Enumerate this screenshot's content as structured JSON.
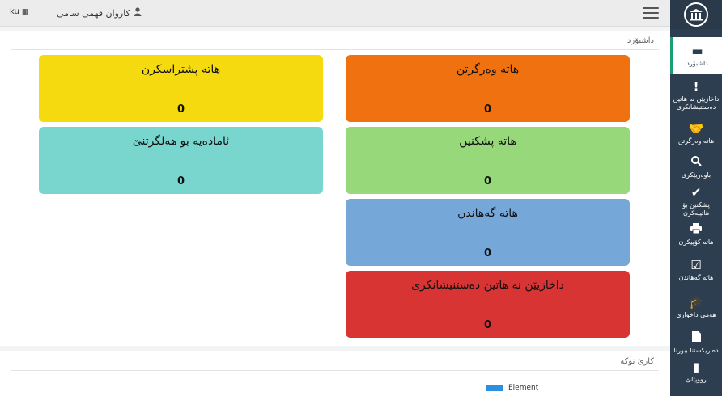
{
  "topbar": {
    "user_name": "کاروان فهمی سامی",
    "language": "ku"
  },
  "sidebar": {
    "items": [
      {
        "label": "داشبۆرد",
        "icon": "dashboard-icon"
      },
      {
        "label": "داخازیێن نە هاتین دەستنیشانکری",
        "icon": "exclamation-icon"
      },
      {
        "label": "هاتە وەرگرتن",
        "icon": "handshake-icon"
      },
      {
        "label": "باوەریێکری",
        "icon": "search-icon"
      },
      {
        "label": "پشکنین بۆ هاتییەکرن",
        "icon": "check-icon"
      },
      {
        "label": "هاتە کۆپیکرن",
        "icon": "printer-icon"
      },
      {
        "label": "هاتە گەهاندن",
        "icon": "checkbox-icon"
      },
      {
        "label": "هەمی داخوازی",
        "icon": "graduation-cap-icon"
      },
      {
        "label": "دە ریکستنا ببورنا",
        "icon": "file-icon"
      },
      {
        "label": "رووپێلێ",
        "icon": "door-icon"
      }
    ]
  },
  "dashboard": {
    "title": "داشبۆرد",
    "cards": [
      {
        "title": "هاتە وەرگرتن",
        "count": "0",
        "color": "#f07110"
      },
      {
        "title": "هاتە پشتراسکرن",
        "count": "0",
        "color": "#f4da0f"
      },
      {
        "title": "هاتە پشکنین",
        "count": "0",
        "color": "#97d87a"
      },
      {
        "title": "ئامادەیە بو هەلگرتنێ",
        "count": "0",
        "color": "#78d6cf"
      },
      {
        "title": "هاتە گەهاندن",
        "count": "0",
        "color": "#76a7d9"
      },
      {
        "title": "داخازیێن نە هاتین دەستنیشانکری",
        "count": "0",
        "color": "#d93434"
      }
    ]
  },
  "work_panel": {
    "title": "کارێ توکە",
    "legend": "Element",
    "legend_color": "#2d8fe0"
  }
}
